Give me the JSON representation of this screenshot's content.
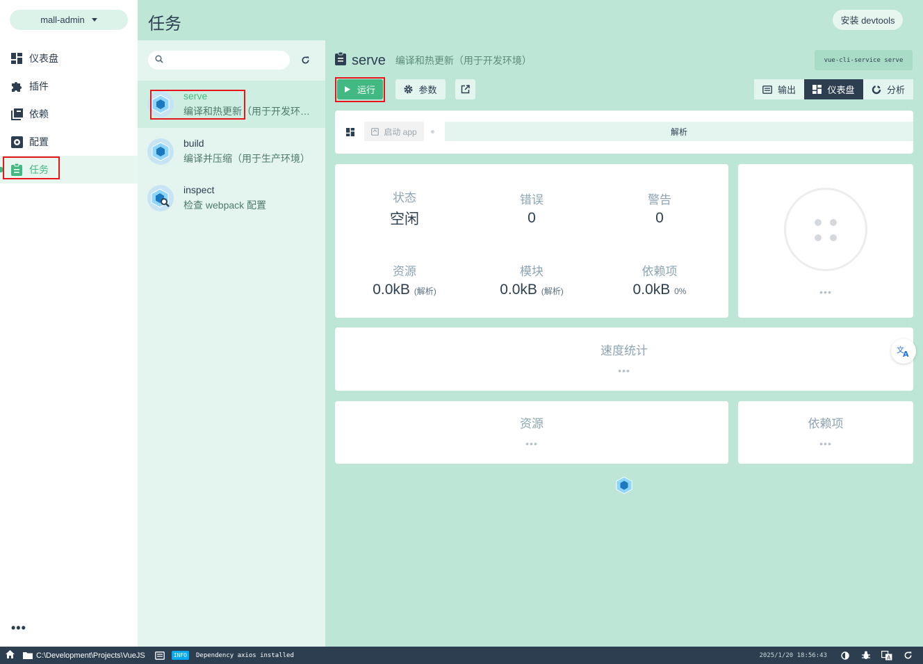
{
  "sidebar": {
    "project": "mall-admin",
    "items": [
      {
        "label": "仪表盘",
        "icon": "dashboard-icon"
      },
      {
        "label": "插件",
        "icon": "puzzle-icon"
      },
      {
        "label": "依赖",
        "icon": "library-icon"
      },
      {
        "label": "配置",
        "icon": "settings-icon"
      },
      {
        "label": "任务",
        "icon": "clipboard-icon",
        "active": true
      }
    ],
    "more": "•••"
  },
  "header": {
    "title": "任务",
    "devtools_button": "安装 devtools"
  },
  "task_list": {
    "search_placeholder": "",
    "tasks": [
      {
        "name": "serve",
        "description": "编译和热更新（用于开发环境）",
        "selected": true
      },
      {
        "name": "build",
        "description": "编译并压缩（用于生产环境）"
      },
      {
        "name": "inspect",
        "description": "检查 webpack 配置"
      }
    ]
  },
  "task_detail": {
    "name": "serve",
    "description": "编译和热更新（用于开发环境）",
    "command": "vue-cli-service serve",
    "run_button": "运行",
    "params_button": "参数",
    "views": {
      "output": "输出",
      "dashboard": "仪表盘",
      "analyze": "分析"
    },
    "steps": {
      "start_app": "启动 app",
      "parse": "解析"
    },
    "stats": {
      "status_label": "状态",
      "status_value": "空闲",
      "errors_label": "错误",
      "errors_value": "0",
      "warnings_label": "警告",
      "warnings_value": "0",
      "assets_label": "资源",
      "assets_value": "0.0kB",
      "assets_note": "(解析)",
      "modules_label": "模块",
      "modules_value": "0.0kB",
      "modules_note": "(解析)",
      "deps_label": "依赖项",
      "deps_value": "0.0kB",
      "deps_note": "0%"
    },
    "status_card_dots": "•••",
    "speed": {
      "title": "速度统计",
      "dots": "•••"
    },
    "assets_section": {
      "title": "资源",
      "dots": "•••"
    },
    "deps_section": {
      "title": "依赖项",
      "dots": "•••"
    }
  },
  "statusbar": {
    "path": "C:\\Development\\Projects\\VueJS",
    "log_level": "INFO",
    "log_message": "Dependency axios installed",
    "datetime": "2025/1/20 18:56:43"
  },
  "colors": {
    "accent": "#42b983",
    "dark": "#2c3e50",
    "highlight": "#e8141c",
    "background": "#bde6d6"
  }
}
